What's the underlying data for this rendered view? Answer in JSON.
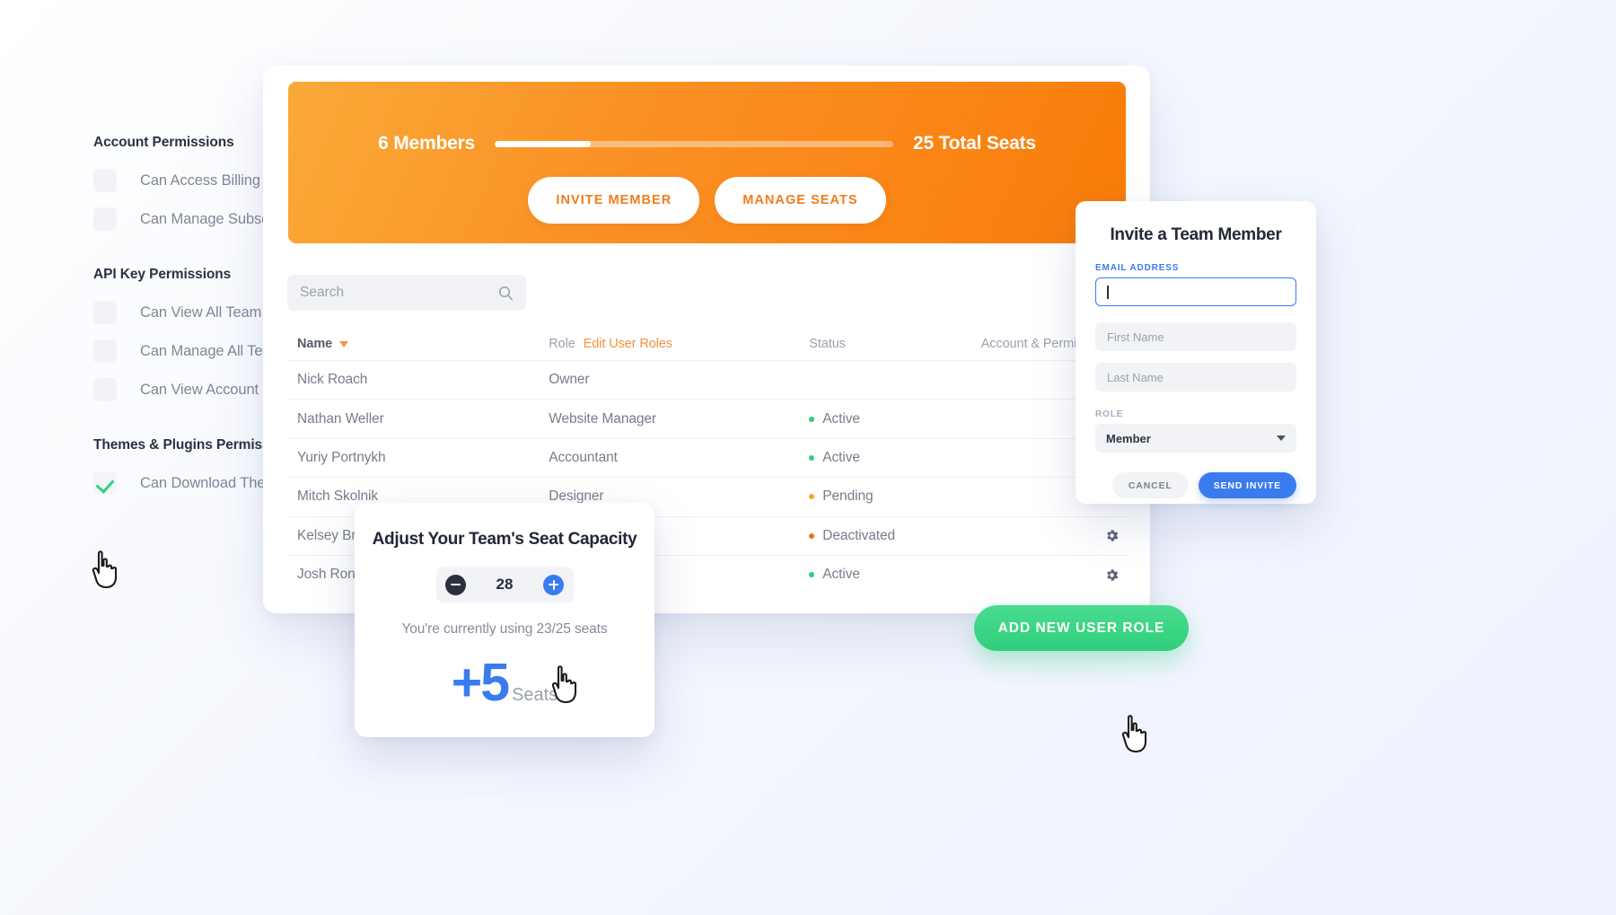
{
  "permissions_panel": {
    "groups": [
      {
        "title": "Account Permissions",
        "items": [
          {
            "label": "Can Access Billing",
            "checked": false
          },
          {
            "label": "Can Manage Subscriptions",
            "checked": false
          }
        ]
      },
      {
        "title": "API Key Permissions",
        "items": [
          {
            "label": "Can View All Team Keys",
            "checked": false
          },
          {
            "label": "Can Manage All Team's Keys",
            "checked": false
          },
          {
            "label": "Can View Account Owner's Keys",
            "checked": false
          }
        ]
      },
      {
        "title": "Themes & Plugins Permissions",
        "items": [
          {
            "label": "Can Download Themes & Plugins",
            "checked": true
          }
        ]
      }
    ]
  },
  "seat_hero": {
    "members_label": "6 Members",
    "total_seats_label": "25 Total Seats",
    "progress_percent": 24,
    "invite_member_button": "INVITE MEMBER",
    "manage_seats_button": "MANAGE SEATS"
  },
  "search": {
    "placeholder": "Search",
    "value": "",
    "icon": "search-icon"
  },
  "members_table": {
    "columns": {
      "name": "Name",
      "role": "Role",
      "status": "Status",
      "account": "Account & Permissions"
    },
    "edit_user_roles_link": "Edit User Roles",
    "sort_icon": "caret-down-icon",
    "gear_icon": "gear-icon",
    "rows": [
      {
        "name": "Nick Roach",
        "role": "Owner",
        "status": "",
        "status_color": "",
        "has_gear": false
      },
      {
        "name": "Nathan Weller",
        "role": "Website Manager",
        "status": "Active",
        "status_color": "#2fcf7c",
        "has_gear": true
      },
      {
        "name": "Yuriy Portnykh",
        "role": "Accountant",
        "status": "Active",
        "status_color": "#2fcf7c",
        "has_gear": true
      },
      {
        "name": "Mitch Skolnik",
        "role": "Designer",
        "status": "Pending",
        "status_color": "#f5a623",
        "has_gear": true
      },
      {
        "name": "Kelsey Brown",
        "role": "",
        "status": "Deactivated",
        "status_color": "#f2711c",
        "has_gear": true
      },
      {
        "name": "Josh Ronk",
        "role": "",
        "status": "Active",
        "status_color": "#2fcf7c",
        "has_gear": true
      }
    ]
  },
  "seat_modal": {
    "title": "Adjust Your Team's Seat Capacity",
    "minus_icon": "minus-circle-icon",
    "plus_icon": "plus-circle-icon",
    "value": "28",
    "usage_text": "You're currently using 23/25 seats",
    "delta": "+5",
    "delta_unit": "Seats"
  },
  "invite_panel": {
    "title": "Invite a Team Member",
    "email_label": "EMAIL ADDRESS",
    "email_value": "",
    "first_name_placeholder": "First Name",
    "last_name_placeholder": "Last Name",
    "role_label": "ROLE",
    "role_value": "Member",
    "cancel_button": "CANCEL",
    "send_invite_button": "SEND INVITE"
  },
  "add_role_button": {
    "label": "ADD NEW USER ROLE"
  },
  "colors": {
    "orange_start": "#faa938",
    "orange_end": "#f97c09",
    "accent_blue": "#3b7bf0",
    "accent_green": "#2fcf7c",
    "pending_amber": "#f5a623",
    "deactivated_orange": "#f2711c"
  }
}
